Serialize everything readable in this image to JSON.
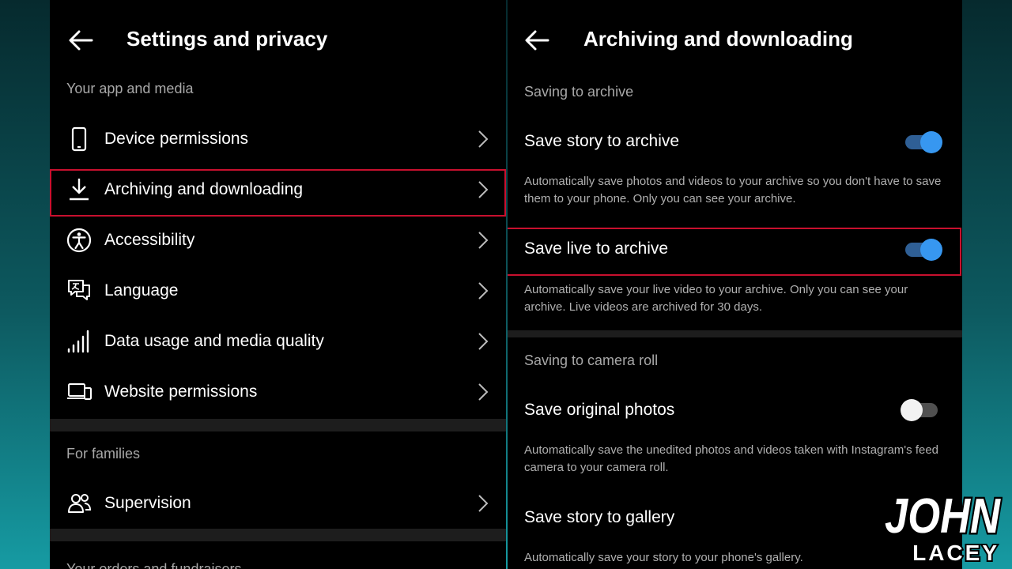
{
  "left": {
    "title": "Settings and privacy",
    "section_app_media": "Your app and media",
    "items": [
      {
        "label": "Device permissions"
      },
      {
        "label": "Archiving and downloading"
      },
      {
        "label": "Accessibility"
      },
      {
        "label": "Language"
      },
      {
        "label": "Data usage and media quality"
      },
      {
        "label": "Website permissions"
      }
    ],
    "section_families": "For families",
    "supervision_label": "Supervision",
    "section_orders": "Your orders and fundraisers"
  },
  "right": {
    "title": "Archiving and downloading",
    "section_archive": "Saving to archive",
    "save_story": {
      "label": "Save story to archive",
      "enabled": true,
      "desc": "Automatically save photos and videos to your archive so you don't have to save them to your phone. Only you can see your archive."
    },
    "save_live": {
      "label": "Save live to archive",
      "enabled": true,
      "desc": "Automatically save your live video to your archive. Only you can see your archive. Live videos are archived for 30 days."
    },
    "section_camera_roll": "Saving to camera roll",
    "save_original": {
      "label": "Save original photos",
      "enabled": false,
      "desc": "Automatically save the unedited photos and videos taken with Instagram's feed camera to your camera roll."
    },
    "save_gallery": {
      "label": "Save story to gallery",
      "desc": "Automatically save your story to your phone's gallery."
    }
  },
  "watermark": {
    "line1": "JOHN",
    "line2": "LACEY"
  },
  "colors": {
    "toggle_on": "#3797f0",
    "highlight": "#c8102e",
    "panel_bg": "#000000"
  }
}
